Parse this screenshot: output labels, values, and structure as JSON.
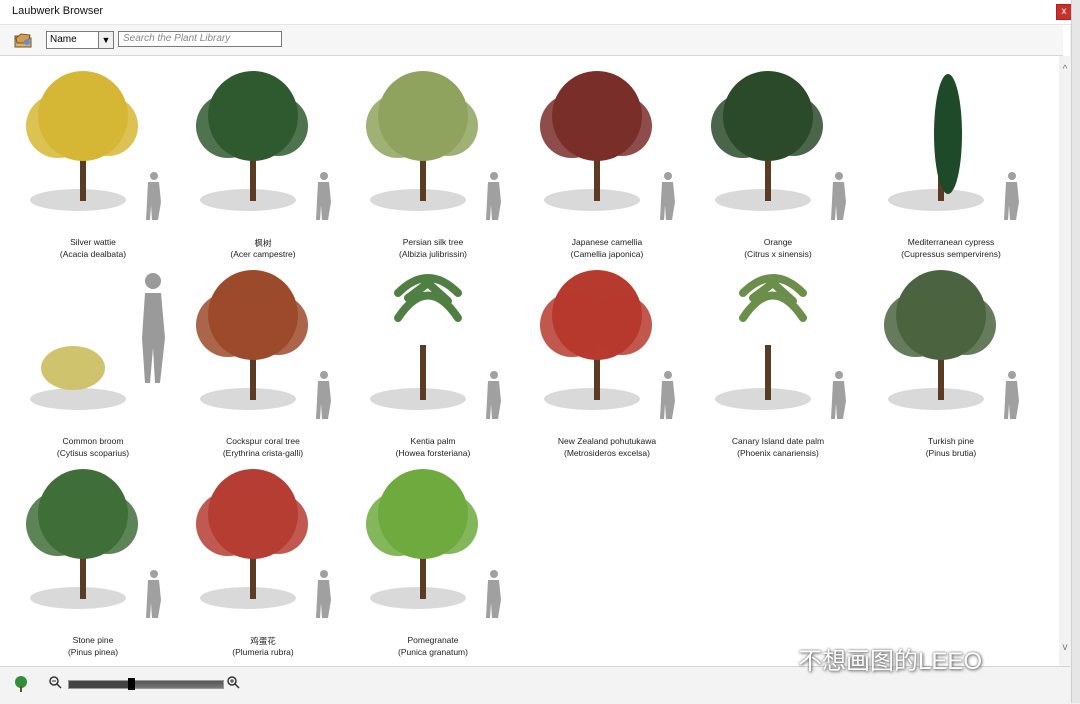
{
  "window": {
    "title": "Laubwerk Browser",
    "close_label": "x"
  },
  "toolbar": {
    "sort_value": "Name",
    "search_placeholder": "Search the Plant Library"
  },
  "plants": [
    {
      "name": "Silver wattie",
      "latin": "(Acacia dealbata)"
    },
    {
      "name": "枫树",
      "latin": "(Acer campestre)"
    },
    {
      "name": "Persian silk tree",
      "latin": "(Albizia julibrissin)"
    },
    {
      "name": "Japanese camellia",
      "latin": "(Camellia japonica)"
    },
    {
      "name": "Orange",
      "latin": "(Citrus x sinensis)"
    },
    {
      "name": "Mediterranean cypress",
      "latin": "(Cupressus sempervirens)"
    },
    {
      "name": "Common broom",
      "latin": "(Cytisus scoparius)"
    },
    {
      "name": "Cockspur coral tree",
      "latin": "(Erythrina crista-galli)"
    },
    {
      "name": "Kentia palm",
      "latin": "(Howea forsteriana)"
    },
    {
      "name": "New Zealand pohutukawa",
      "latin": "(Metrosideros excelsa)"
    },
    {
      "name": "Canary Island date palm",
      "latin": "(Phoenix canariensis)"
    },
    {
      "name": "Turkish pine",
      "latin": "(Pinus brutia)"
    },
    {
      "name": "Stone pine",
      "latin": "(Pinus pinea)"
    },
    {
      "name": "鸡蛋花",
      "latin": "(Plumeria rubra)"
    },
    {
      "name": "Pomegranate",
      "latin": "(Punica granatum)"
    }
  ],
  "zoom": {
    "level": 0.4
  },
  "watermark": "不想画图的LEEO",
  "icons": {
    "folder": "folder-icon",
    "tree": "tree-mode-icon",
    "zoom_out": "zoom-out-icon",
    "zoom_in": "zoom-in-icon"
  }
}
